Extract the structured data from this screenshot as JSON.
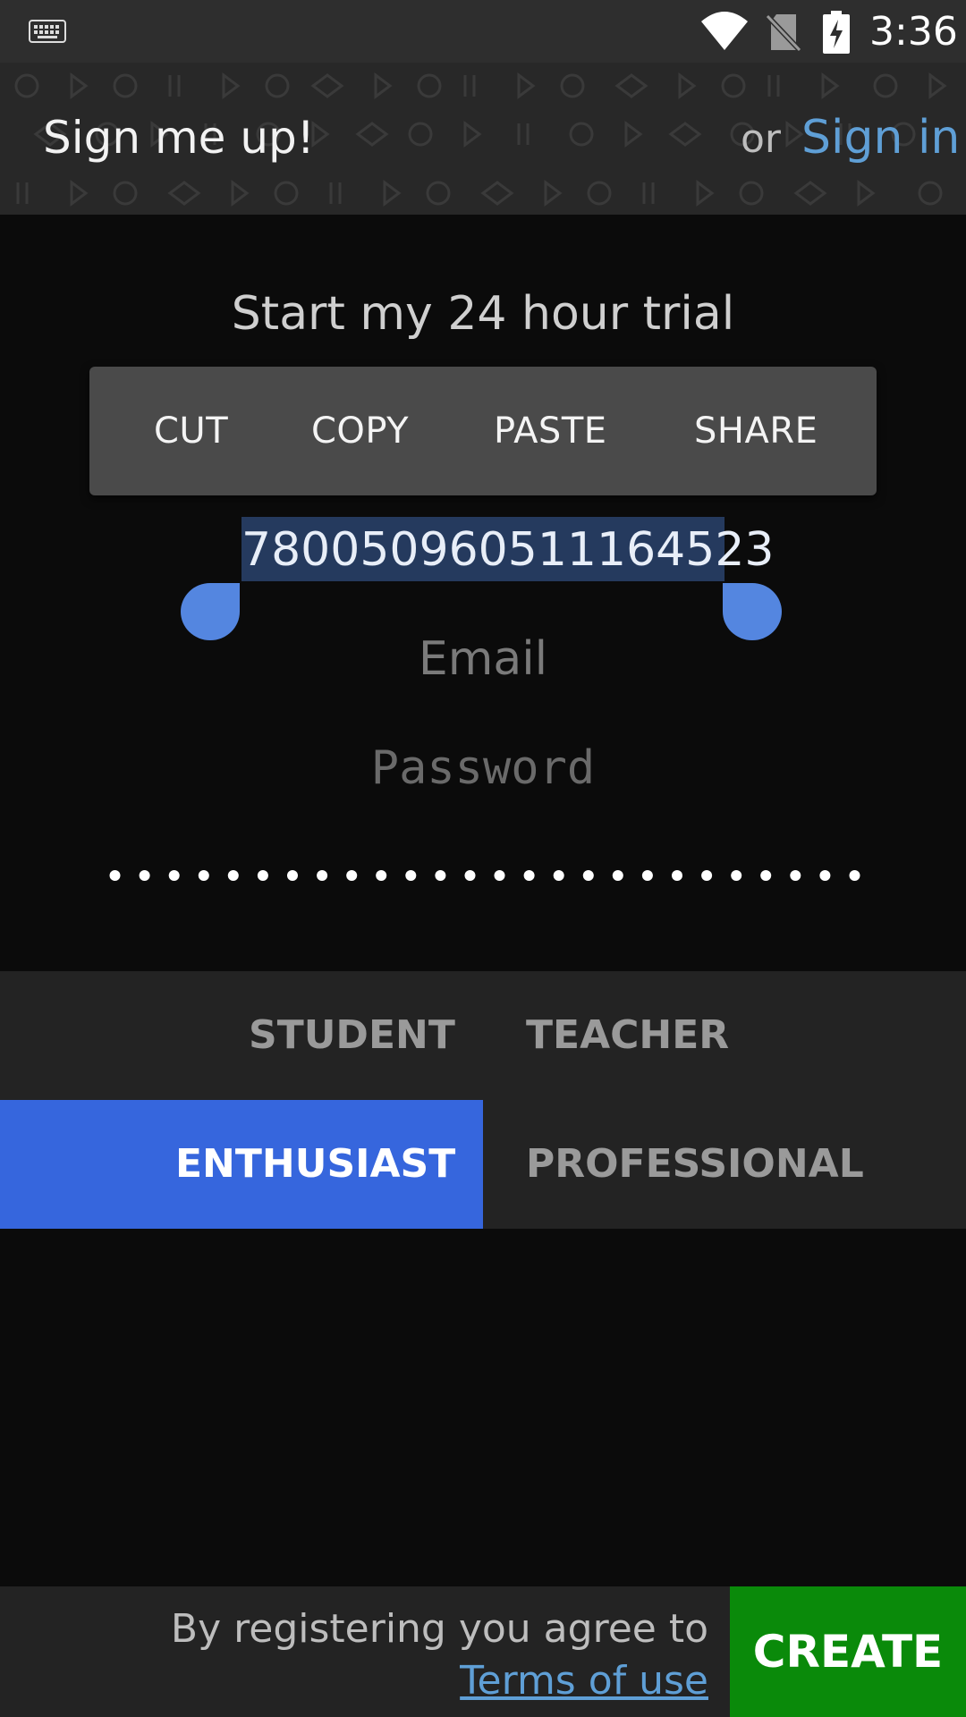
{
  "status_bar": {
    "time": "3:36",
    "icons": [
      "keyboard-icon",
      "wifi-icon",
      "no-sim-icon",
      "battery-charging-icon"
    ]
  },
  "header": {
    "title": "Sign me up!",
    "or_text": "or",
    "signin_label": "Sign in"
  },
  "main": {
    "trial_heading": "Start my 24 hour trial",
    "context_menu": [
      "CUT",
      "COPY",
      "PASTE",
      "SHARE"
    ],
    "username_value": "780050960511164523",
    "email_placeholder": "Email",
    "password_placeholder": "Password",
    "password_confirm_value": "••••••••••••••••••••••••••"
  },
  "roles": {
    "options": [
      "STUDENT",
      "TEACHER",
      "ENTHUSIAST",
      "PROFESSIONAL"
    ],
    "selected": "ENTHUSIAST"
  },
  "footer": {
    "agree_text": "By registering you agree to",
    "terms_label": "Terms of use",
    "create_label": "CREATE"
  },
  "colors": {
    "accent_blue": "#3666dd",
    "link_blue": "#5f9fd6",
    "create_green": "#0a8a0a",
    "selection_bg": "#253a5e"
  }
}
